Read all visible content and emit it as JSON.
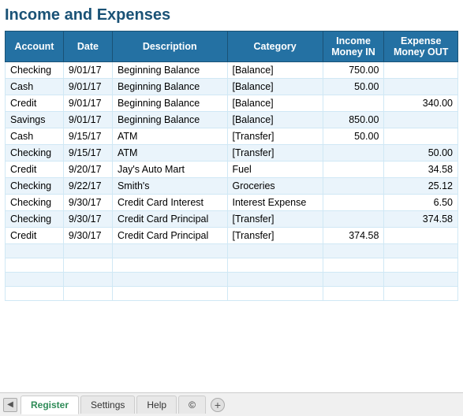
{
  "page": {
    "title": "Income and Expenses"
  },
  "table": {
    "headers": [
      {
        "label": "Account",
        "id": "account"
      },
      {
        "label": "Date",
        "id": "date"
      },
      {
        "label": "Description",
        "id": "description"
      },
      {
        "label": "Category",
        "id": "category"
      },
      {
        "label": "Income\nMoney IN",
        "id": "income"
      },
      {
        "label": "Expense\nMoney OUT",
        "id": "expense"
      }
    ],
    "rows": [
      {
        "account": "Checking",
        "date": "9/01/17",
        "description": "Beginning Balance",
        "category": "[Balance]",
        "income": "750.00",
        "expense": ""
      },
      {
        "account": "Cash",
        "date": "9/01/17",
        "description": "Beginning Balance",
        "category": "[Balance]",
        "income": "50.00",
        "expense": ""
      },
      {
        "account": "Credit",
        "date": "9/01/17",
        "description": "Beginning Balance",
        "category": "[Balance]",
        "income": "",
        "expense": "340.00"
      },
      {
        "account": "Savings",
        "date": "9/01/17",
        "description": "Beginning Balance",
        "category": "[Balance]",
        "income": "850.00",
        "expense": ""
      },
      {
        "account": "Cash",
        "date": "9/15/17",
        "description": "ATM",
        "category": "[Transfer]",
        "income": "50.00",
        "expense": ""
      },
      {
        "account": "Checking",
        "date": "9/15/17",
        "description": "ATM",
        "category": "[Transfer]",
        "income": "",
        "expense": "50.00"
      },
      {
        "account": "Credit",
        "date": "9/20/17",
        "description": "Jay's Auto Mart",
        "category": "Fuel",
        "income": "",
        "expense": "34.58"
      },
      {
        "account": "Checking",
        "date": "9/22/17",
        "description": "Smith's",
        "category": "Groceries",
        "income": "",
        "expense": "25.12"
      },
      {
        "account": "Checking",
        "date": "9/30/17",
        "description": "Credit Card Interest",
        "category": "Interest Expense",
        "income": "",
        "expense": "6.50"
      },
      {
        "account": "Checking",
        "date": "9/30/17",
        "description": "Credit Card Principal",
        "category": "[Transfer]",
        "income": "",
        "expense": "374.58"
      },
      {
        "account": "Credit",
        "date": "9/30/17",
        "description": "Credit Card Principal",
        "category": "[Transfer]",
        "income": "374.58",
        "expense": ""
      }
    ],
    "empty_rows": 4
  },
  "tabs": [
    {
      "label": "Register",
      "active": true
    },
    {
      "label": "Settings",
      "active": false
    },
    {
      "label": "Help",
      "active": false
    },
    {
      "label": "©",
      "active": false
    }
  ],
  "icons": {
    "scroll_left": "◀",
    "scroll_right": "▶",
    "add": "+"
  }
}
